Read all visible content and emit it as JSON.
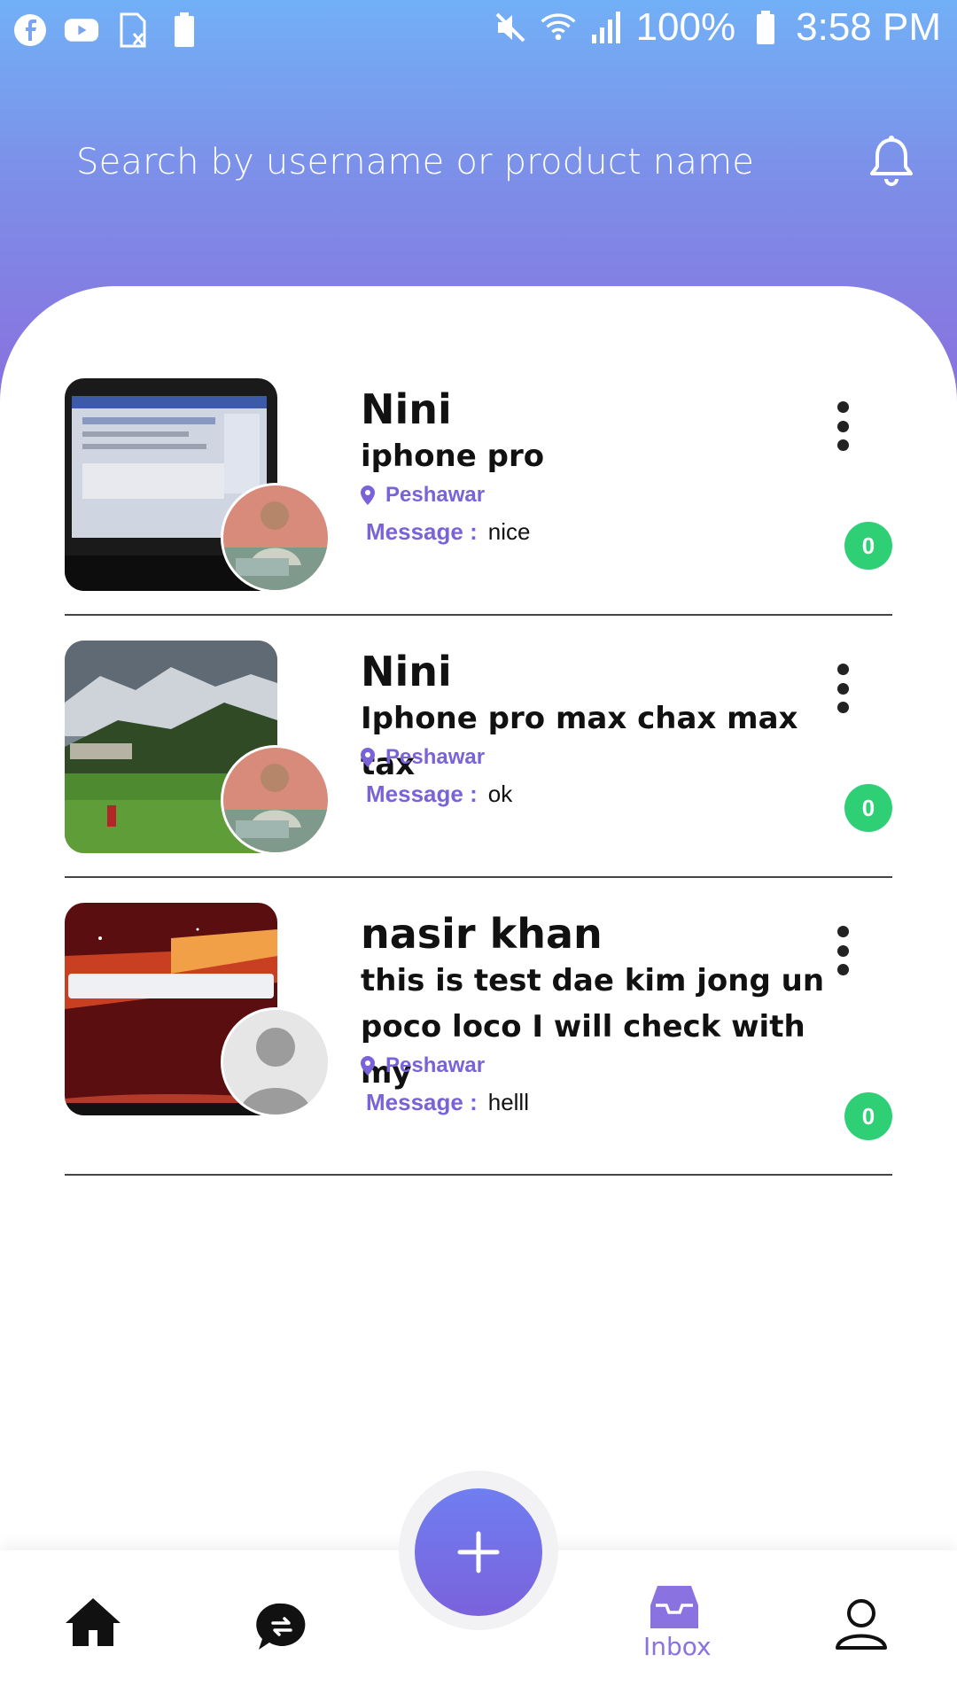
{
  "status_bar": {
    "battery": "100%",
    "time": "3:58 PM",
    "left_icons": [
      "facebook-icon",
      "youtube-icon",
      "sim-icon",
      "battery-saver-icon"
    ],
    "right_icons": [
      "mute-icon",
      "wifi-icon",
      "signal-icon",
      "battery-icon"
    ]
  },
  "header": {
    "search_placeholder": "Search by username or product name"
  },
  "messages_list": [
    {
      "name": "Nini",
      "product": "iphone pro",
      "location": "Peshawar",
      "message_label": "Message :",
      "message": "nice",
      "unread": "0"
    },
    {
      "name": "Nini",
      "product": "Iphone pro max chax max tax",
      "location": "Peshawar",
      "message_label": "Message :",
      "message": "ok",
      "unread": "0"
    },
    {
      "name": "nasir khan",
      "product": "this is test dae kim jong un poco loco I will check with my",
      "location": "Peshawar",
      "message_label": "Message :",
      "message": "helll",
      "unread": "0"
    }
  ],
  "bottom_nav": {
    "items": [
      "home-icon",
      "exchange-icon",
      "add-icon",
      "inbox-icon",
      "profile-icon"
    ],
    "inbox_label": "Inbox",
    "accent": "#8a72e0"
  },
  "colors": {
    "header_top": "#72b0f6",
    "header_bottom": "#8a6fdd",
    "badge": "#2ecf75"
  }
}
